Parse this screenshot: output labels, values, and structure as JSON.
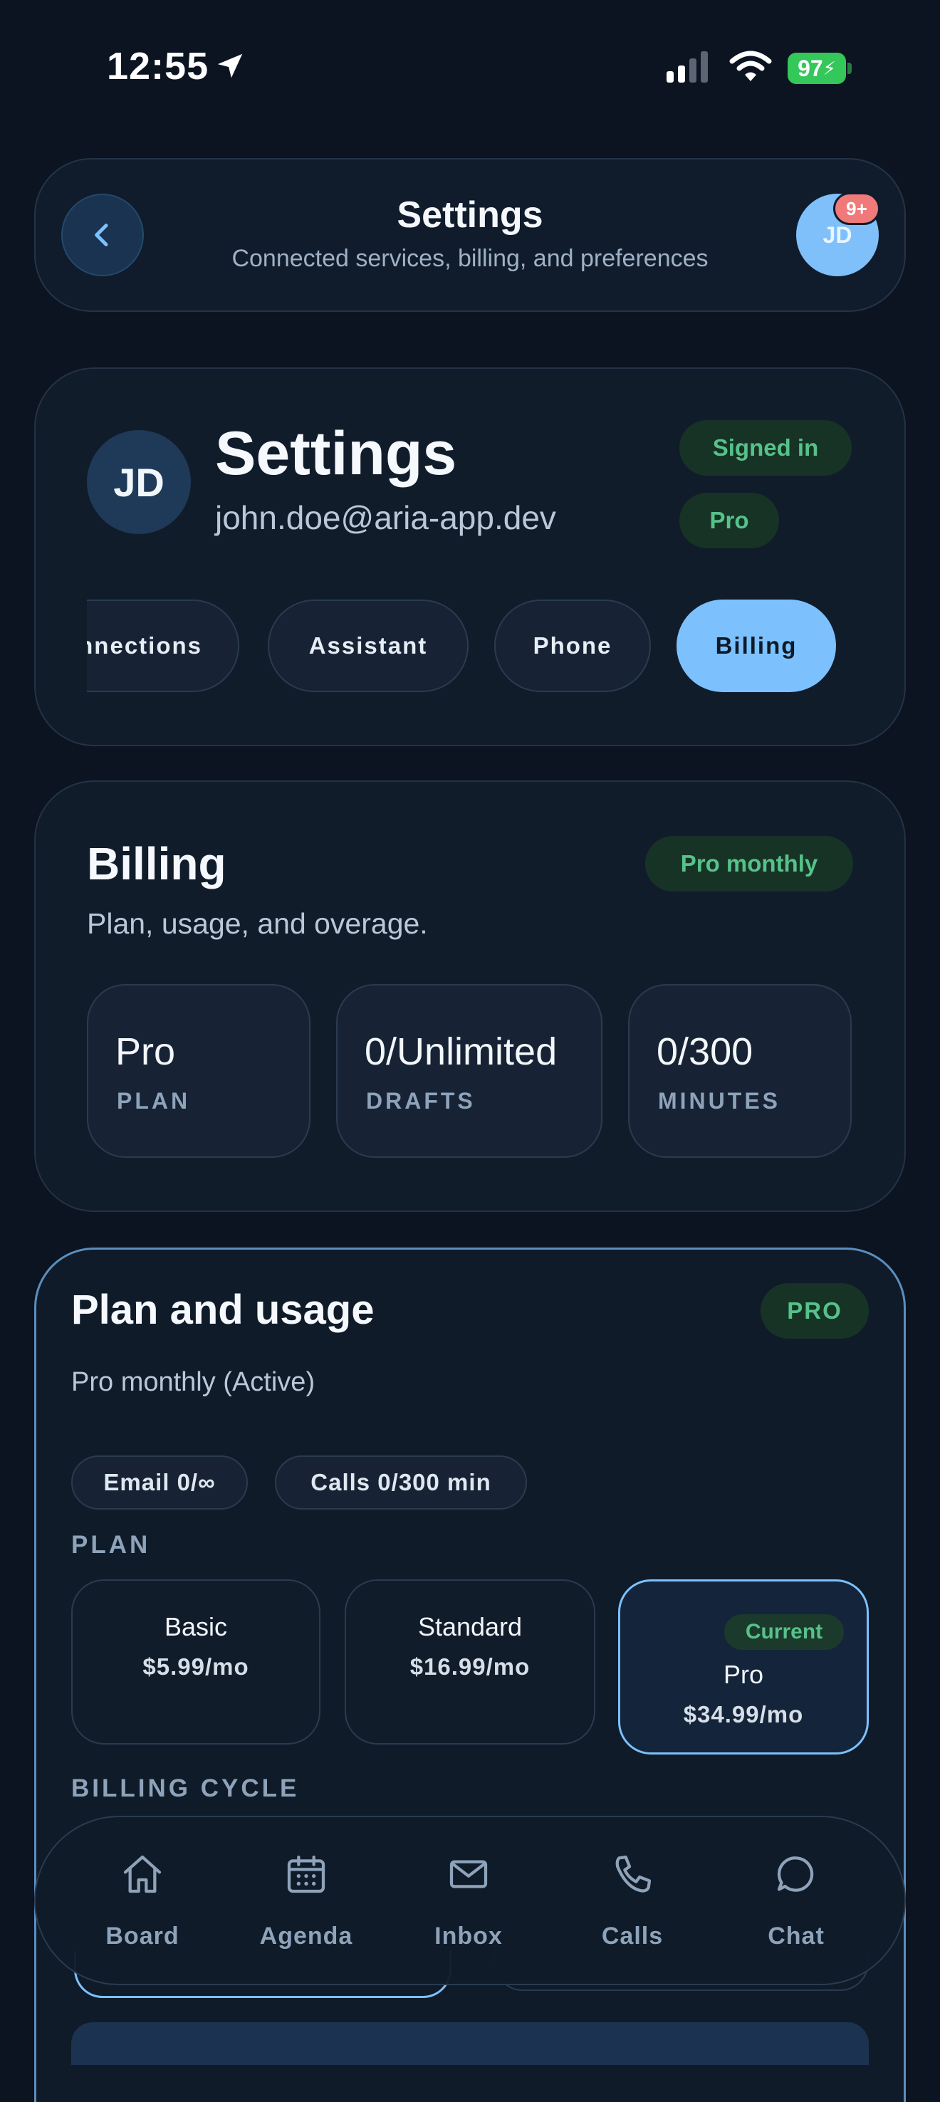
{
  "status_bar": {
    "time": "12:55",
    "battery": "97"
  },
  "header": {
    "title": "Settings",
    "subtitle": "Connected services, billing, and preferences",
    "avatar_initials": "JD",
    "notification_badge": "9+"
  },
  "profile": {
    "initials": "JD",
    "title": "Settings",
    "email": "john.doe@aria-app.dev",
    "status_pill": "Signed in",
    "plan_pill": "Pro",
    "tabs": [
      {
        "label": "Connections"
      },
      {
        "label": "Assistant"
      },
      {
        "label": "Phone"
      },
      {
        "label": "Billing",
        "active": true
      }
    ]
  },
  "billing": {
    "title": "Billing",
    "subtitle": "Plan, usage, and overage.",
    "plan_pill": "Pro monthly",
    "stats": [
      {
        "value": "Pro",
        "label": "PLAN"
      },
      {
        "value": "0/Unlimited",
        "label": "DRAFTS"
      },
      {
        "value": "0/300",
        "label": "MINUTES"
      }
    ]
  },
  "plan_usage": {
    "title": "Plan and usage",
    "subtitle": "Pro monthly (Active)",
    "tier_pill": "PRO",
    "usage_chips": [
      "Email 0/∞",
      "Calls 0/300 min"
    ],
    "plan_section_label": "PLAN",
    "plans": [
      {
        "name": "Basic",
        "price": "$5.99/mo"
      },
      {
        "name": "Standard",
        "price": "$16.99/mo"
      },
      {
        "name": "Pro",
        "price": "$34.99/mo",
        "current": true,
        "badge": "Current"
      }
    ],
    "billing_cycle_label": "BILLING CYCLE"
  },
  "bottom_nav": [
    {
      "label": "Board",
      "icon": "home-icon"
    },
    {
      "label": "Agenda",
      "icon": "calendar-icon"
    },
    {
      "label": "Inbox",
      "icon": "mail-icon"
    },
    {
      "label": "Calls",
      "icon": "phone-icon"
    },
    {
      "label": "Chat",
      "icon": "chat-icon"
    }
  ],
  "colors": {
    "background": "#0b1420",
    "card": "#111c2b",
    "accent": "#7cc1fd",
    "success": "#56c28a",
    "badge": "#f07a7a"
  }
}
